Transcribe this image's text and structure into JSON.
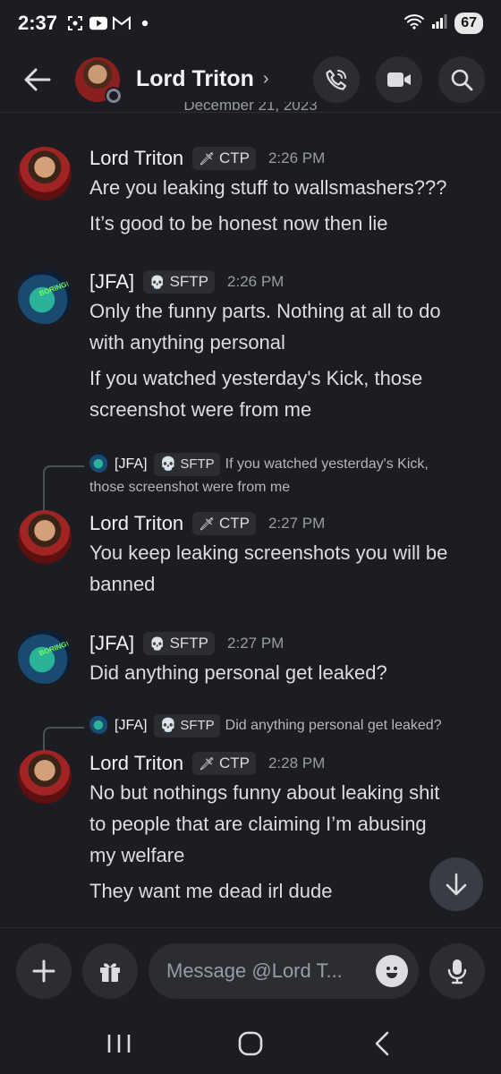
{
  "status_bar": {
    "time": "2:37",
    "icons_left": [
      "screenshot-icon",
      "youtube-icon",
      "gmail-icon",
      "dot-icon"
    ],
    "battery": "67",
    "icons_right": [
      "wifi-icon",
      "signal-icon"
    ]
  },
  "header": {
    "title": "Lord Triton",
    "chevron": "›",
    "actions": [
      "call-icon",
      "video-icon",
      "search-icon"
    ]
  },
  "date_divider": "December 21, 2023",
  "messages": [
    {
      "author": "Lord Triton",
      "tag_icon": "🗡",
      "tag": "CTP",
      "time": "2:26 PM",
      "lines": [
        "Are you leaking stuff to wallsmashers???",
        "It’s good to be honest now then lie"
      ]
    },
    {
      "author": "[JFA]",
      "tag_icon": "💀",
      "tag": "SFTP",
      "time": "2:26 PM",
      "lines": [
        "Only the funny parts. Nothing at all to do",
        "with anything personal",
        "If you watched yesterday's Kick, those",
        "screenshot were from me"
      ]
    },
    {
      "reply": {
        "author": "[JFA]",
        "tag_icon": "💀",
        "tag": "SFTP",
        "text_1": "If you watched yesterday's Kick,",
        "text_2": "those screenshot were from me"
      },
      "author": "Lord Triton",
      "tag_icon": "🗡",
      "tag": "CTP",
      "time": "2:27 PM",
      "lines": [
        "You keep leaking screenshots you will be",
        "banned"
      ]
    },
    {
      "author": "[JFA]",
      "tag_icon": "💀",
      "tag": "SFTP",
      "time": "2:27 PM",
      "lines": [
        "Did anything personal get leaked?"
      ]
    },
    {
      "reply": {
        "author": "[JFA]",
        "tag_icon": "💀",
        "tag": "SFTP",
        "text_1": "Did anything personal get leaked?"
      },
      "author": "Lord Triton",
      "tag_icon": "🗡",
      "tag": "CTP",
      "time": "2:28 PM",
      "lines": [
        "No but nothings funny about leaking shit",
        "to people that are claiming I’m abusing",
        "my welfare",
        "They want me dead irl dude"
      ]
    }
  ],
  "composer": {
    "placeholder": "Message @Lord T..."
  },
  "colors": {
    "background": "#1c1d22",
    "surface": "#2b2d33",
    "text": "#f2f3f5",
    "muted": "#9a9ca3"
  }
}
